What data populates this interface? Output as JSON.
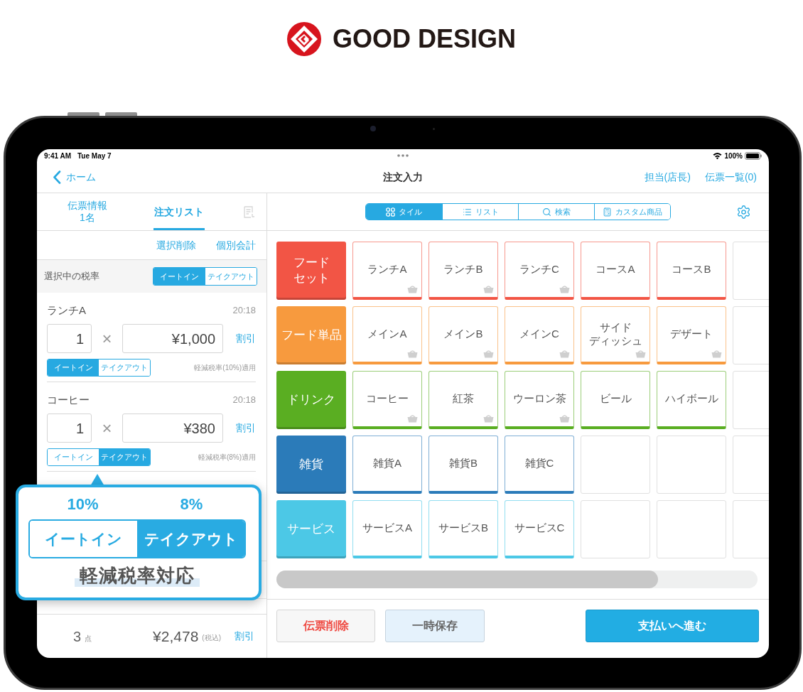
{
  "logo": {
    "text": "GOOD DESIGN"
  },
  "status_bar": {
    "time": "9:41 AM",
    "date": "Tue May 7",
    "battery": "100%"
  },
  "nav_bar": {
    "back": "ホーム",
    "title": "注文入力",
    "links": [
      "担当(店長)",
      "伝票一覧(0)"
    ]
  },
  "order_panel": {
    "tabs": [
      {
        "label": "伝票情報",
        "sublabel": "1名",
        "selected": false
      },
      {
        "label": "注文リスト",
        "selected": true
      }
    ],
    "actions": [
      "選択削除",
      "個別会計"
    ],
    "tax_rate": {
      "label": "選択中の税率",
      "options": [
        {
          "label": "イートイン",
          "selected": true
        },
        {
          "label": "テイクアウト",
          "selected": false
        }
      ]
    },
    "items": [
      {
        "name": "ランチA",
        "time": "20:18",
        "quantity": "1",
        "operator": "×",
        "price": "¥1,000",
        "discount": "割引",
        "options": [
          {
            "label": "イートイン",
            "selected": true
          },
          {
            "label": "テイクアウト",
            "selected": false
          }
        ],
        "tax_note": "軽減税率(10%)適用"
      },
      {
        "name": "コーヒー",
        "time": "20:18",
        "quantity": "1",
        "operator": "×",
        "price": "¥380",
        "discount": "割引",
        "options": [
          {
            "label": "イートイン",
            "selected": false
          },
          {
            "label": "テイクアウト",
            "selected": true
          }
        ],
        "tax_note": "軽減税率(8%)適用"
      }
    ],
    "footer": {
      "count": "3",
      "count_unit": "点",
      "total": "¥2,478",
      "tax_label": "(税込)",
      "discount": "割引"
    }
  },
  "product_panel": {
    "view_tabs": [
      {
        "label": "タイル",
        "selected": true
      },
      {
        "label": "リスト",
        "selected": false
      },
      {
        "label": "検索",
        "selected": false
      },
      {
        "label": "カスタム商品",
        "selected": false
      }
    ],
    "rows": [
      {
        "category": "フードセット",
        "color": "#f25545",
        "items": [
          {
            "label": "ランチA",
            "basket_icon": true
          },
          {
            "label": "ランチB",
            "basket_icon": true
          },
          {
            "label": "ランチC",
            "basket_icon": true
          },
          {
            "label": "コースA",
            "basket_icon": false
          },
          {
            "label": "コースB",
            "basket_icon": false
          }
        ]
      },
      {
        "category": "フード単品",
        "color": "#f79a3e",
        "items": [
          {
            "label": "メインA",
            "basket_icon": true
          },
          {
            "label": "メインB",
            "basket_icon": true
          },
          {
            "label": "メインC",
            "basket_icon": true
          },
          {
            "label": "サイドディッシュ",
            "basket_icon": true
          },
          {
            "label": "デザート",
            "basket_icon": true
          }
        ]
      },
      {
        "category": "ドリンク",
        "color": "#5aae22",
        "items": [
          {
            "label": "コーヒー",
            "basket_icon": true
          },
          {
            "label": "紅茶",
            "basket_icon": true
          },
          {
            "label": "ウーロン茶",
            "basket_icon": true
          },
          {
            "label": "ビール",
            "basket_icon": false
          },
          {
            "label": "ハイボール",
            "basket_icon": false
          }
        ]
      },
      {
        "category": "雑貨",
        "color": "#2b7bb9",
        "items": [
          {
            "label": "雑貨A",
            "basket_icon": false
          },
          {
            "label": "雑貨B",
            "basket_icon": false
          },
          {
            "label": "雑貨C",
            "basket_icon": false
          }
        ]
      },
      {
        "category": "サービス",
        "color": "#4cc8e6",
        "items": [
          {
            "label": "サービスA",
            "basket_icon": false
          },
          {
            "label": "サービスB",
            "basket_icon": false
          },
          {
            "label": "サービスC",
            "basket_icon": false
          }
        ]
      }
    ],
    "buttons": [
      {
        "label": "伝票削除",
        "kind": "danger"
      },
      {
        "label": "一時保存",
        "kind": "secondary"
      },
      {
        "label": "支払いへ進む",
        "kind": "primary"
      }
    ]
  },
  "callout": {
    "options": [
      {
        "rate": "10%",
        "label": "イートイン",
        "selected": false
      },
      {
        "rate": "8%",
        "label": "テイクアウト",
        "selected": true
      }
    ],
    "caption": "軽減税率対応"
  }
}
